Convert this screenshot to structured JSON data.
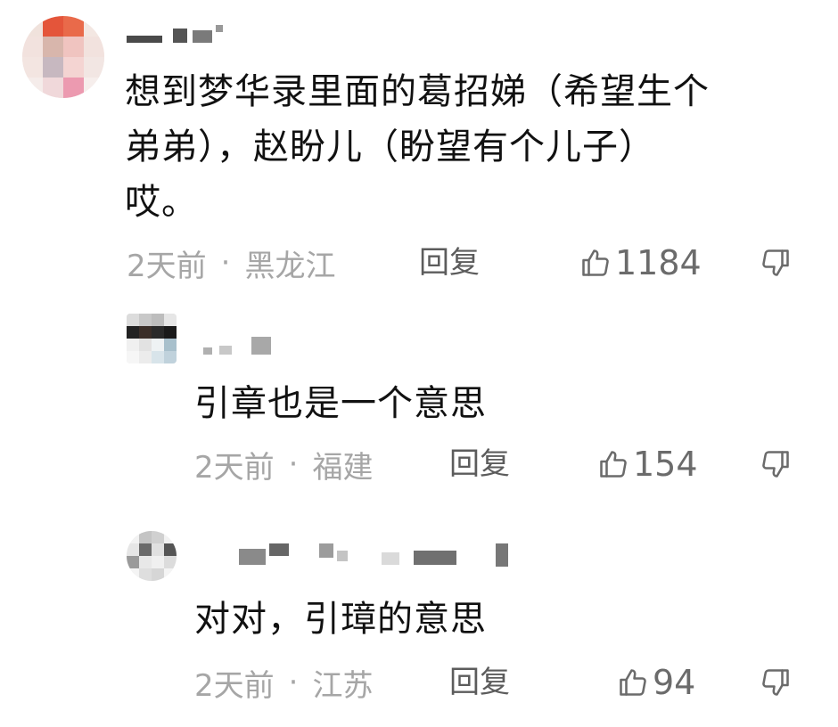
{
  "comments": [
    {
      "text": "想到梦华录里面的葛招娣（希望生个\n弟弟），赵盼儿（盼望有个儿子）\n哎。",
      "time": "2天前",
      "separator": "·",
      "location": "黑龙江",
      "reply_label": "回复",
      "likes": "1184",
      "like_icon": "thumbs-up-icon",
      "dislike_icon": "thumbs-down-icon"
    },
    {
      "text": "引章也是一个意思",
      "time": "2天前",
      "separator": "·",
      "location": "福建",
      "reply_label": "回复",
      "likes": "154",
      "like_icon": "thumbs-up-icon",
      "dislike_icon": "thumbs-down-icon"
    },
    {
      "text": "对对，引璋的意思",
      "time": "2天前",
      "separator": "·",
      "location": "江苏",
      "reply_label": "回复",
      "likes": "94",
      "like_icon": "thumbs-up-icon",
      "dislike_icon": "thumbs-down-icon"
    }
  ],
  "colors": {
    "text": "#111111",
    "meta": "#a6a6a6",
    "reply": "#5c5c5c",
    "likes": "#6b6b6b"
  }
}
